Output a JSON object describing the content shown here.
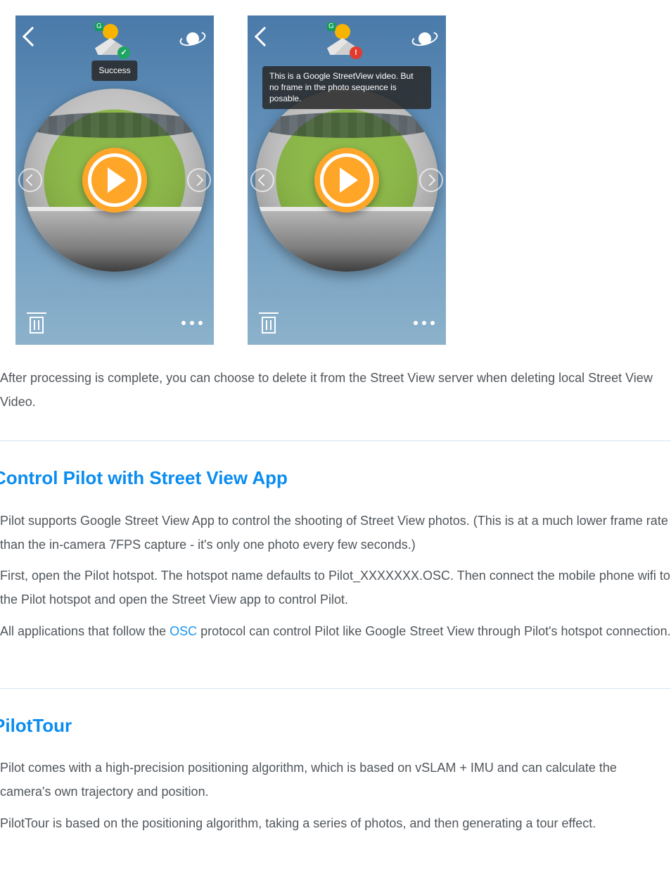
{
  "screenshots": {
    "left": {
      "badge_letter": "G",
      "status": "ok",
      "status_glyph": "✓",
      "toast": "Success"
    },
    "right": {
      "badge_letter": "G",
      "status": "err",
      "status_glyph": "!",
      "toast": "This is a Google StreetView video. But no frame in the photo sequence is posable."
    }
  },
  "para_after_screens": "After processing is complete, you can choose to delete it from the Street View server when deleting local Street View Video.",
  "section1": {
    "heading": "Control Pilot with Street View App",
    "p1": "Pilot supports Google Street View App to control the shooting of Street View photos. (This is at a much lower frame rate than the in-camera 7FPS capture - it's only one photo every few seconds.)",
    "p2": "First, open the Pilot hotspot. The hotspot name defaults to Pilot_XXXXXXX.OSC. Then connect the mobile phone wifi to the Pilot hotspot and open the Street View app to control Pilot.",
    "p3_pre": "All applications that follow the ",
    "p3_link": "OSC",
    "p3_post": " protocol can control Pilot like Google Street View through Pilot's hotspot connection."
  },
  "section2": {
    "heading": "PilotTour",
    "p1": "Pilot comes with a high-precision positioning algorithm, which is based on vSLAM + IMU and can calculate the camera's own trajectory and position.",
    "p2": "PilotTour is based on the positioning algorithm, taking a series of photos, and then generating a tour effect."
  }
}
